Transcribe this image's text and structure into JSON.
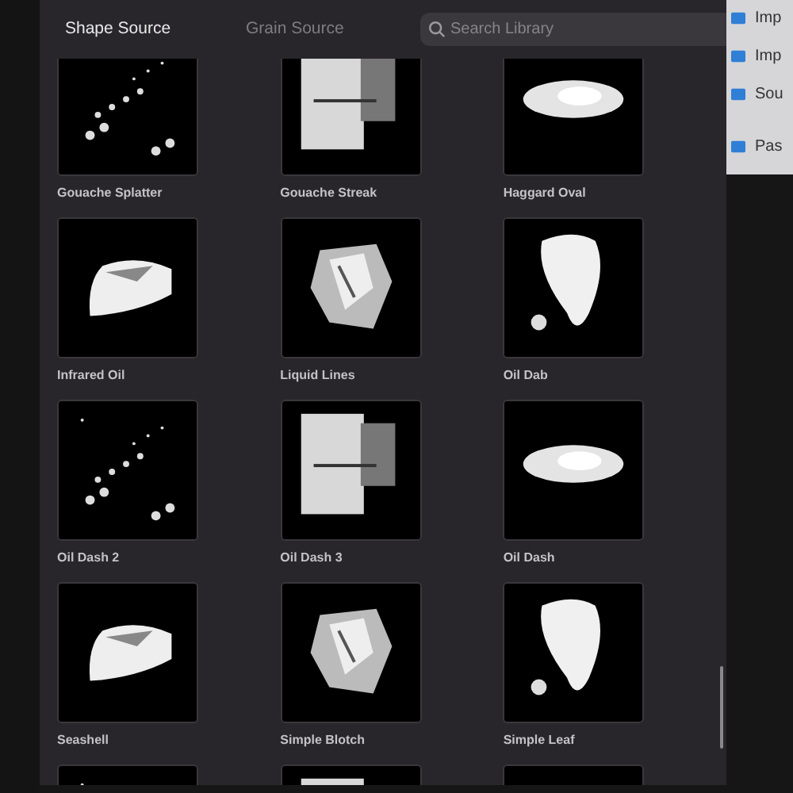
{
  "tabs": [
    {
      "label": "Shape Source",
      "selected": true
    },
    {
      "label": "Grain Source",
      "selected": false
    }
  ],
  "search": {
    "placeholder": "Search Library"
  },
  "library": [
    {
      "label": "Gouache Splatter"
    },
    {
      "label": "Gouache Streak"
    },
    {
      "label": "Haggard Oval"
    },
    {
      "label": "Infrared Oil"
    },
    {
      "label": "Liquid Lines"
    },
    {
      "label": "Oil Dab"
    },
    {
      "label": "Oil Dash 2"
    },
    {
      "label": "Oil Dash 3"
    },
    {
      "label": "Oil Dash"
    },
    {
      "label": "Seashell"
    },
    {
      "label": "Simple Blotch"
    },
    {
      "label": "Simple Leaf"
    },
    {
      "kind": "picture"
    },
    {
      "kind": "picture"
    },
    {
      "kind": "picture"
    }
  ],
  "side_menu": [
    {
      "label": "Imp"
    },
    {
      "label": "Imp"
    },
    {
      "label": "Sou"
    },
    {
      "label": "Pas"
    }
  ]
}
